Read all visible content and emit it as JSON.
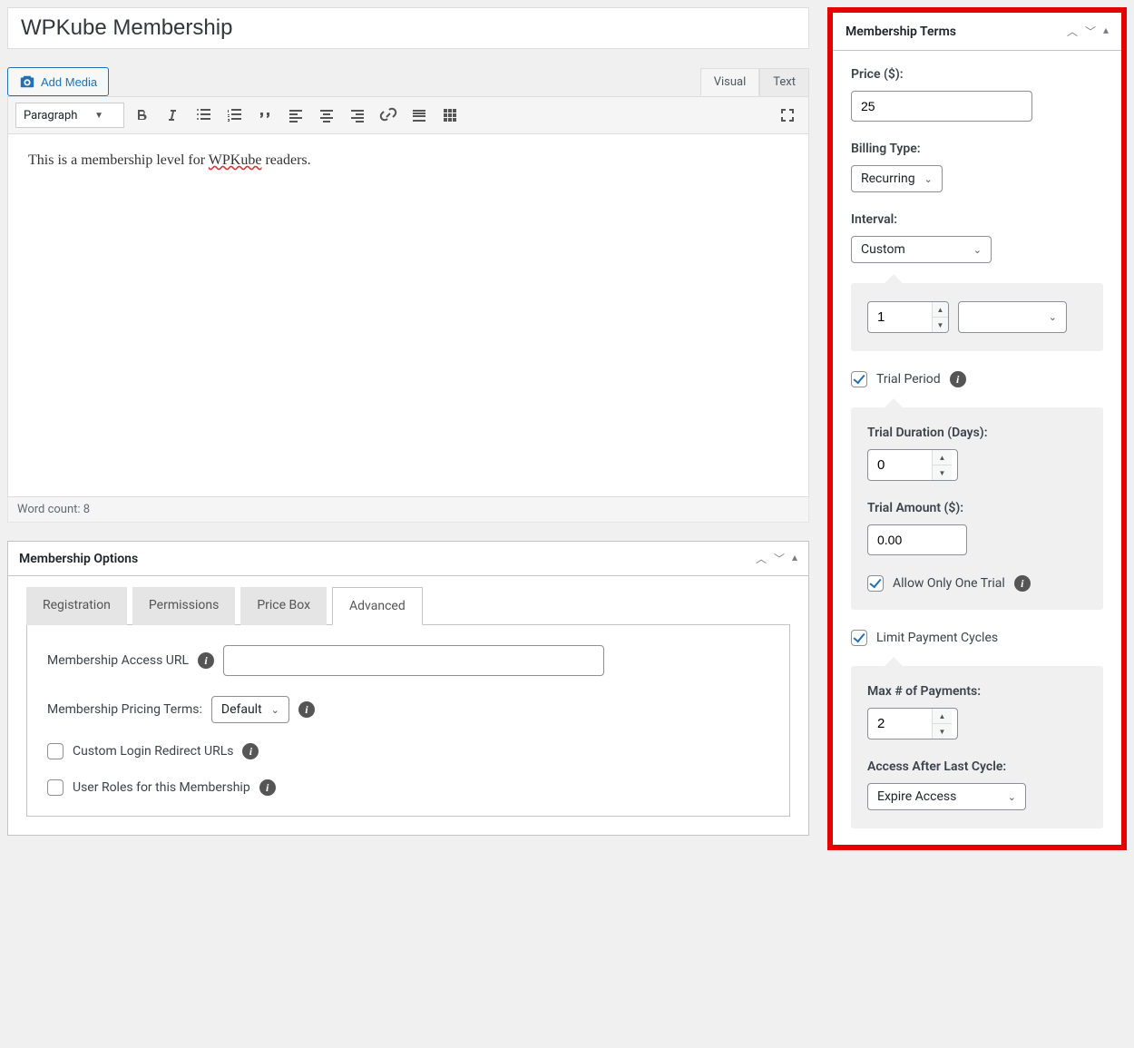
{
  "title": "WPKube Membership",
  "media": {
    "add_label": "Add Media"
  },
  "editor": {
    "tabs": {
      "visual": "Visual",
      "text": "Text",
      "active": "Visual"
    },
    "format_select": "Paragraph",
    "content": {
      "prefix": "This is a membership level for ",
      "underlined": "WPKube",
      "suffix": " readers."
    },
    "word_count_label": "Word count: 8"
  },
  "options": {
    "title": "Membership Options",
    "tabs": [
      "Registration",
      "Permissions",
      "Price Box",
      "Advanced"
    ],
    "active_tab": "Advanced",
    "fields": {
      "access_url_label": "Membership Access URL",
      "access_url_value": "",
      "pricing_terms_label": "Membership Pricing Terms:",
      "pricing_terms_value": "Default",
      "custom_login_label": "Custom Login Redirect URLs",
      "user_roles_label": "User Roles for this Membership"
    }
  },
  "terms": {
    "title": "Membership Terms",
    "price_label": "Price ($):",
    "price_value": "25",
    "billing_label": "Billing Type:",
    "billing_value": "Recurring",
    "interval_label": "Interval:",
    "interval_value": "Custom",
    "custom_amount": "1",
    "trial_label": "Trial Period",
    "trial_checked": true,
    "trial_duration_label": "Trial Duration (Days):",
    "trial_duration_value": "0",
    "trial_amount_label": "Trial Amount ($):",
    "trial_amount_value": "0.00",
    "one_trial_label": "Allow Only One Trial",
    "one_trial_checked": true,
    "limit_cycles_label": "Limit Payment Cycles",
    "limit_cycles_checked": true,
    "max_payments_label": "Max # of Payments:",
    "max_payments_value": "2",
    "access_after_label": "Access After Last Cycle:",
    "access_after_value": "Expire Access"
  }
}
